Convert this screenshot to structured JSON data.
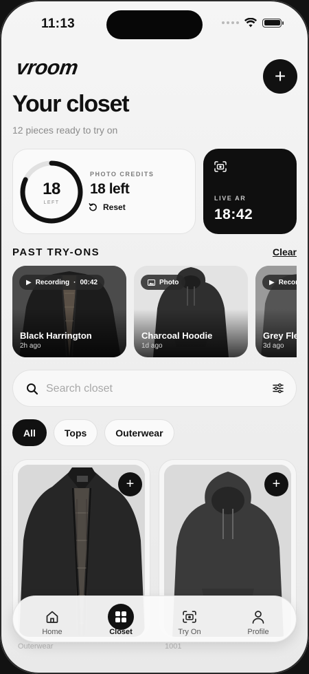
{
  "status_bar": {
    "time": "11:13"
  },
  "header": {
    "brand": "vroom",
    "title": "Your closet",
    "subtitle": "12 pieces ready to try on"
  },
  "credits": {
    "count": "18",
    "ring_label": "LEFT",
    "label": "PHOTO CREDITS",
    "value": "18 left",
    "reset_label": "Reset",
    "fraction_shown": 0.82
  },
  "live_ar": {
    "label": "LIVE AR",
    "time": "18:42"
  },
  "past_tryons": {
    "title": "PAST TRY-ONS",
    "clear_label": "Clear",
    "items": [
      {
        "badge": "Recording",
        "duration": "00:42",
        "name": "Black Harrington",
        "time": "2h ago"
      },
      {
        "badge": "Photo",
        "duration": "",
        "name": "Charcoal Hoodie",
        "time": "1d ago"
      },
      {
        "badge": "Recording",
        "duration": "",
        "name": "Grey Fle",
        "time": "3d ago"
      }
    ]
  },
  "search": {
    "placeholder": "Search closet"
  },
  "filters": {
    "items": [
      "All",
      "Tops",
      "Outerwear"
    ],
    "selected": "All"
  },
  "nav": {
    "items": [
      {
        "label": "Home",
        "icon": "home-icon"
      },
      {
        "label": "Closet",
        "icon": "grid-icon"
      },
      {
        "label": "Try On",
        "icon": "camera-icon"
      },
      {
        "label": "Profile",
        "icon": "user-icon"
      }
    ],
    "active": "Closet"
  },
  "behind_nav": {
    "left": "Outerwear",
    "right": "1001"
  },
  "colors": {
    "accent": "#111111",
    "background": "#f1f1f1",
    "card": "#fafafa"
  }
}
